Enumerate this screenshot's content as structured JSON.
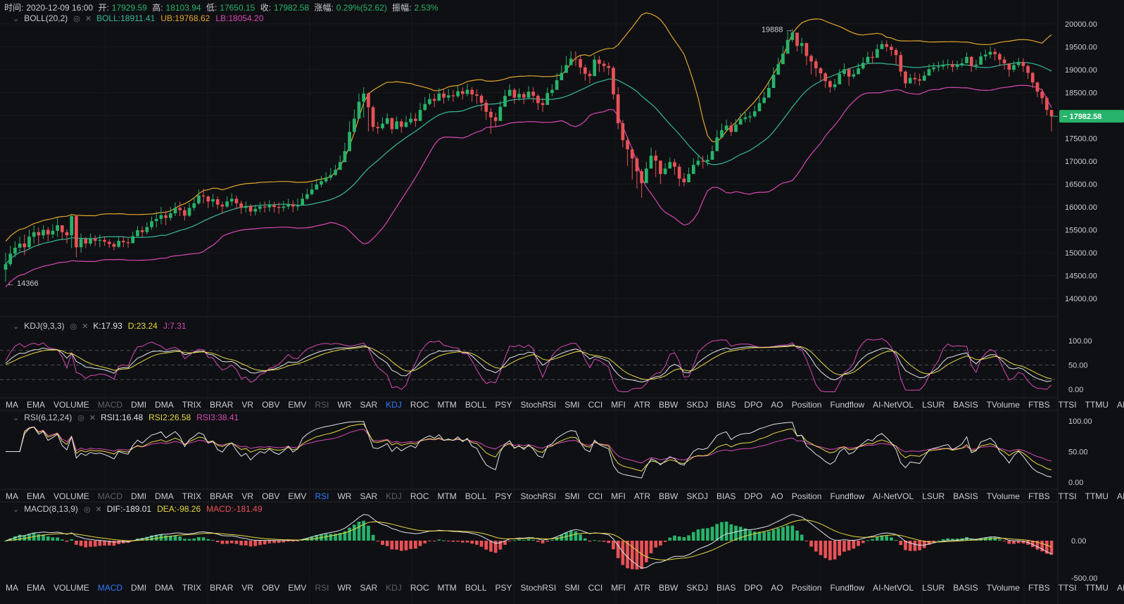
{
  "info": {
    "time_label": "时间:",
    "time": "2020-12-09 16:00",
    "open_label": "开:",
    "open": "17929.59",
    "high_label": "高:",
    "high": "18103.94",
    "low_label": "低:",
    "low": "17650.15",
    "close_label": "收:",
    "close": "17982.58",
    "change_label": "涨幅:",
    "change": "0.29%(52.62)",
    "amp_label": "振幅:",
    "amp": "2.53%"
  },
  "colors": {
    "up": "#28b36a",
    "down": "#e85256",
    "mid": "#36b89a",
    "upper": "#e0a52c",
    "lower": "#d848b4",
    "k": "#dfe3e8",
    "d": "#e8d843",
    "j": "#d848b4",
    "price_tag": "#28b36a"
  },
  "panels": {
    "boll": {
      "name": "BOLL(20,2)",
      "mid": "BOLL:18911.41",
      "ub": "UB:19768.62",
      "lb": "LB:18054.20"
    },
    "kdj": {
      "name": "KDJ(9,3,3)",
      "k": "K:17.93",
      "d": "D:23.24",
      "j": "J:7.31"
    },
    "rsi": {
      "name": "RSI(6,12,24)",
      "r1": "RSI1:16.48",
      "r2": "RSI2:26.58",
      "r3": "RSI3:38.41"
    },
    "macd": {
      "name": "MACD(8,13,9)",
      "dif": "DIF:-189.01",
      "dea": "DEA:-98.26",
      "macd": "MACD:-181.49"
    }
  },
  "tabs": [
    "MA",
    "EMA",
    "VOLUME",
    "MACD",
    "DMI",
    "DMA",
    "TRIX",
    "BRAR",
    "VR",
    "OBV",
    "EMV",
    "RSI",
    "WR",
    "SAR",
    "KDJ",
    "ROC",
    "MTM",
    "BOLL",
    "PSY",
    "StochRSI",
    "SMI",
    "CCI",
    "MFI",
    "ATR",
    "BBW",
    "SKDJ",
    "BIAS",
    "DPO",
    "AO",
    "Position",
    "Fundflow",
    "AI-NetVOL",
    "LSUR",
    "BASIS",
    "TVolume",
    "FTBS",
    "TTSI",
    "TTMU",
    "AI-BSI"
  ],
  "tab_rows": [
    {
      "active": "KDJ",
      "dim": [
        "MACD",
        "RSI"
      ]
    },
    {
      "active": "RSI",
      "dim": [
        "MACD",
        "KDJ"
      ]
    },
    {
      "active": "MACD",
      "dim": [
        "RSI",
        "KDJ"
      ]
    }
  ],
  "chart_data": {
    "type": "candlestick",
    "interval_start": "2020-12-09 16:00",
    "price_axis": {
      "ticks": [
        "20000.00",
        "19500.00",
        "19000.00",
        "18500.00",
        "18000.00",
        "17500.00",
        "17000.00",
        "16500.00",
        "16000.00",
        "15500.00",
        "15000.00",
        "14500.00",
        "14000.00"
      ],
      "range": [
        13850,
        20300
      ]
    },
    "last_price": "17982.58",
    "annotations": {
      "max": "19888",
      "min": "14366"
    },
    "kdj_axis": [
      "100.00",
      "50.00",
      "0.00"
    ],
    "rsi_axis": [
      "100.00",
      "50.00",
      "0.00"
    ],
    "macd_axis": [
      "0.00",
      "-500.00"
    ],
    "close": [
      14750,
      14980,
      15110,
      15200,
      15120,
      15350,
      15450,
      15380,
      15500,
      15400,
      15480,
      15600,
      15450,
      15380,
      15800,
      15120,
      15300,
      15200,
      15310,
      15260,
      15280,
      15240,
      15190,
      15130,
      15260,
      15230,
      15210,
      15360,
      15490,
      15450,
      15560,
      15690,
      15740,
      15820,
      15760,
      15860,
      15980,
      15930,
      15810,
      15980,
      16080,
      16250,
      16230,
      16120,
      16170,
      16050,
      16010,
      16120,
      16180,
      16080,
      15980,
      16020,
      15900,
      15960,
      16010,
      15990,
      16040,
      16000,
      15980,
      16010,
      16060,
      16010,
      16040,
      16180,
      16280,
      16380,
      16490,
      16560,
      16640,
      16700,
      16810,
      16980,
      17220,
      17640,
      17930,
      18300,
      18480,
      18180,
      17750,
      17720,
      17820,
      17940,
      17700,
      17870,
      17750,
      17850,
      17930,
      17880,
      18120,
      18250,
      18360,
      18320,
      18480,
      18390,
      18440,
      18420,
      18530,
      18470,
      18560,
      18460,
      18430,
      18280,
      18080,
      17960,
      17880,
      18190,
      18430,
      18560,
      18390,
      18470,
      18390,
      18520,
      18430,
      18270,
      18230,
      18490,
      18560,
      18770,
      18930,
      19100,
      19240,
      19230,
      19050,
      18910,
      18860,
      19220,
      19130,
      19080,
      19040,
      18460,
      17830,
      17460,
      17260,
      17060,
      16780,
      16520,
      16840,
      17120,
      17010,
      16720,
      16840,
      16980,
      16880,
      16620,
      16540,
      16720,
      16920,
      17010,
      16990,
      17030,
      17220,
      17520,
      17680,
      17780,
      17640,
      17800,
      17920,
      17960,
      17980,
      18090,
      18270,
      18390,
      18600,
      18890,
      19120,
      19350,
      19650,
      19810,
      19520,
      19580,
      19300,
      19180,
      19030,
      18920,
      18750,
      18620,
      18680,
      18910,
      19010,
      18850,
      18900,
      19030,
      19150,
      19280,
      19260,
      19450,
      19560,
      19500,
      19430,
      19320,
      18960,
      18700,
      18820,
      18790,
      18760,
      18870,
      19010,
      19050,
      19070,
      19100,
      19120,
      19060,
      19100,
      19140,
      19280,
      19080,
      19110,
      19290,
      19330,
      19390,
      19340,
      19220,
      19140,
      19000,
      19100,
      19170,
      19080,
      18930,
      18720,
      18520,
      18380,
      18120,
      17980
    ],
    "high": [
      15000,
      15150,
      15250,
      15350,
      15400,
      15500,
      15600,
      15550,
      15600,
      15560,
      15620,
      15760,
      15600,
      15510,
      15840,
      15820,
      15420,
      15340,
      15420,
      15380,
      15400,
      15350,
      15290,
      15240,
      15340,
      15360,
      15320,
      15460,
      15580,
      15580,
      15660,
      15790,
      15900,
      16000,
      15920,
      16000,
      16100,
      16120,
      16000,
      16080,
      16200,
      16380,
      16400,
      16250,
      16280,
      16230,
      16120,
      16230,
      16300,
      16250,
      16140,
      16120,
      16060,
      16050,
      16100,
      16120,
      16150,
      16110,
      16100,
      16130,
      16180,
      16140,
      16180,
      16300,
      16400,
      16520,
      16620,
      16680,
      16760,
      16850,
      16920,
      17120,
      17400,
      17880,
      18130,
      18480,
      18620,
      18500,
      18220,
      17860,
      17960,
      18050,
      17960,
      17980,
      17920,
      17990,
      18060,
      18050,
      18280,
      18400,
      18480,
      18480,
      18600,
      18560,
      18580,
      18560,
      18650,
      18620,
      18690,
      18620,
      18570,
      18470,
      18350,
      18160,
      18060,
      18320,
      18560,
      18680,
      18600,
      18590,
      18520,
      18640,
      18620,
      18470,
      18380,
      18610,
      18680,
      18930,
      19100,
      19300,
      19400,
      19400,
      19300,
      19110,
      18980,
      19320,
      19300,
      19200,
      19160,
      19080,
      18620,
      17900,
      17540,
      17300,
      17110,
      16830,
      16980,
      17300,
      17240,
      17020,
      16960,
      17080,
      17050,
      16940,
      16740,
      16860,
      17060,
      17150,
      17120,
      17140,
      17340,
      17680,
      17820,
      17910,
      17850,
      17920,
      18050,
      18090,
      18080,
      18210,
      18400,
      18520,
      18760,
      19050,
      19260,
      19520,
      19840,
      19888,
      19780,
      19700,
      19590,
      19340,
      19240,
      19060,
      18950,
      18780,
      18800,
      19010,
      19140,
      19040,
      19000,
      19140,
      19270,
      19390,
      19400,
      19560,
      19640,
      19640,
      19560,
      19480,
      19400,
      18980,
      18910,
      18940,
      18910,
      18960,
      19120,
      19150,
      19180,
      19210,
      19230,
      19200,
      19200,
      19250,
      19380,
      19300,
      19210,
      19380,
      19440,
      19500,
      19460,
      19380,
      19290,
      19140,
      19190,
      19260,
      19250,
      19110,
      18950,
      18740,
      18580,
      18420,
      18104
    ],
    "low": [
      14366,
      14700,
      14900,
      15000,
      14950,
      15100,
      15200,
      15150,
      15300,
      15250,
      15320,
      15350,
      15300,
      15200,
      15100,
      14900,
      15000,
      15100,
      15150,
      15150,
      15120,
      15150,
      15100,
      15050,
      15100,
      15120,
      15110,
      15200,
      15350,
      15350,
      15400,
      15500,
      15550,
      15620,
      15600,
      15700,
      15800,
      15800,
      15700,
      15780,
      15920,
      16050,
      16080,
      15980,
      16000,
      15950,
      15850,
      15980,
      16030,
      15950,
      15850,
      15880,
      15800,
      15820,
      15880,
      15880,
      15900,
      15880,
      15850,
      15900,
      15950,
      15880,
      15920,
      16050,
      16150,
      16250,
      16380,
      16430,
      16520,
      16580,
      16680,
      16850,
      17100,
      17480,
      17800,
      18100,
      17950,
      17650,
      17650,
      17600,
      17680,
      17800,
      17600,
      17700,
      17620,
      17730,
      17800,
      17750,
      18000,
      18100,
      18220,
      18180,
      18350,
      18260,
      18320,
      18300,
      18380,
      18350,
      18420,
      18300,
      18250,
      18100,
      17900,
      17600,
      17750,
      18050,
      18300,
      18420,
      18250,
      18320,
      18250,
      18380,
      18280,
      18120,
      18080,
      18350,
      18420,
      18600,
      18800,
      18980,
      19100,
      19080,
      18900,
      18760,
      18700,
      19100,
      18950,
      18950,
      18880,
      18350,
      17700,
      17300,
      16900,
      16600,
      16400,
      16200,
      16700,
      16950,
      16650,
      16500,
      16700,
      16850,
      16700,
      16450,
      16450,
      16600,
      16800,
      16880,
      16840,
      16900,
      17100,
      17400,
      17550,
      17650,
      17550,
      17680,
      17800,
      17850,
      17850,
      17950,
      18150,
      18280,
      18480,
      18750,
      19000,
      19200,
      19500,
      19600,
      19400,
      19350,
      19100,
      18900,
      18850,
      18750,
      18600,
      18500,
      18550,
      18800,
      18850,
      18650,
      18800,
      18900,
      19000,
      19150,
      19150,
      19350,
      19450,
      19400,
      19300,
      19100,
      18850,
      18600,
      18700,
      18680,
      18650,
      18750,
      18900,
      18950,
      18960,
      19000,
      19020,
      18950,
      19000,
      19050,
      19150,
      18950,
      19000,
      19150,
      19200,
      19250,
      19200,
      19080,
      19000,
      18850,
      18950,
      19050,
      18950,
      18800,
      18600,
      18400,
      18250,
      18000,
      17650
    ]
  }
}
